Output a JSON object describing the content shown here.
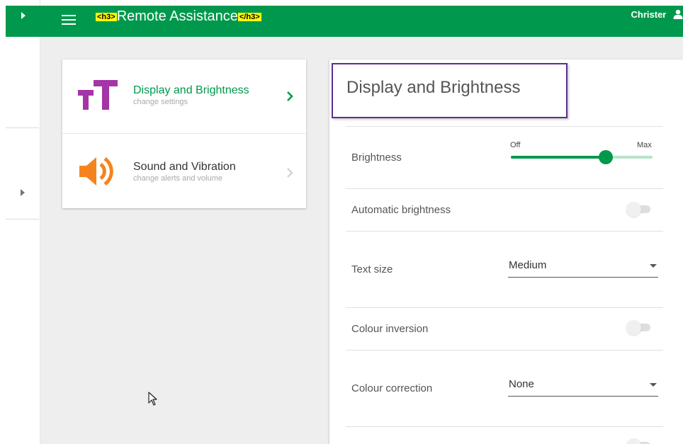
{
  "header": {
    "tag_open": "<h3>",
    "title": "Remote Assistance",
    "tag_close": "</h3>",
    "user_name": "Christer",
    "bg_color": "#00984d"
  },
  "rail": {
    "expand_icon": "caret-right-icon"
  },
  "menu": {
    "items": [
      {
        "label": "Display and Brightness",
        "subtitle": "change settings",
        "icon": "text-size-icon",
        "icon_color": "#a435a6",
        "label_color": "#00984d",
        "active": true
      },
      {
        "label": "Sound and Vibration",
        "subtitle": "change alerts and volume",
        "icon": "speaker-icon",
        "icon_color": "#f5841f",
        "active": false
      }
    ]
  },
  "panel": {
    "title": "Display and Brightness",
    "brightness": {
      "label": "Brightness",
      "min_label": "Off",
      "max_label": "Max",
      "level": 0.67
    },
    "auto_brightness": {
      "label": "Automatic brightness",
      "on": false
    },
    "text_size": {
      "label": "Text size",
      "value": "Medium"
    },
    "colour_inversion": {
      "label": "Colour inversion",
      "on": false
    },
    "colour_correction": {
      "label": "Colour correction",
      "value": "None"
    }
  }
}
